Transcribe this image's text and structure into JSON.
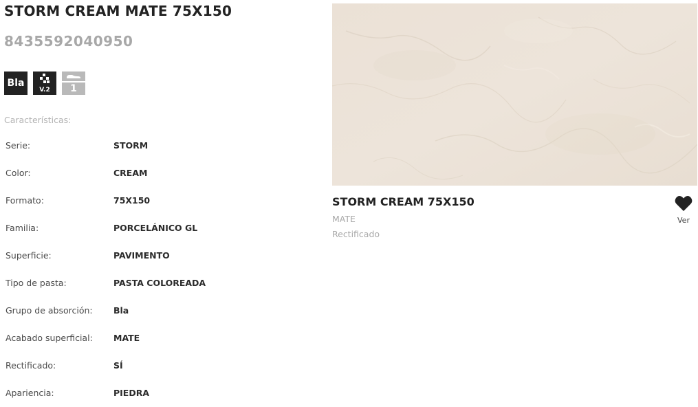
{
  "product": {
    "title": "STORM CREAM MATE 75X150",
    "ean": "8435592040950"
  },
  "badges": [
    {
      "icon": "absorption-group-badge",
      "text": "Bla"
    },
    {
      "icon": "pattern-variation-badge",
      "text": "V.2"
    },
    {
      "icon": "floor-traffic-badge",
      "text": "1"
    }
  ],
  "features": {
    "heading": "Características:",
    "rows": [
      {
        "label": "Serie:",
        "value": "STORM"
      },
      {
        "label": "Color:",
        "value": "CREAM"
      },
      {
        "label": "Formato:",
        "value": "75X150"
      },
      {
        "label": "Familia:",
        "value": "PORCELÁNICO GL"
      },
      {
        "label": "Superficie:",
        "value": "PAVIMENTO"
      },
      {
        "label": "Tipo de pasta:",
        "value": "PASTA COLOREADA"
      },
      {
        "label": "Grupo de absorción:",
        "value": "Bla"
      },
      {
        "label": "Acabado superficial:",
        "value": "MATE"
      },
      {
        "label": "Rectificado:",
        "value": "SÍ"
      },
      {
        "label": "Apariencia:",
        "value": "PIEDRA"
      }
    ]
  },
  "card": {
    "title": "STORM CREAM 75X150",
    "finish": "MATE",
    "rectified": "Rectificado",
    "favorite_icon": "heart-icon",
    "favorite_label": "Ver"
  },
  "colors": {
    "tile_base": "#ece3d9",
    "text_dark": "#222222",
    "text_muted": "#a8a8a8",
    "badge_dark": "#222222",
    "badge_light": "#b9b9b9"
  }
}
